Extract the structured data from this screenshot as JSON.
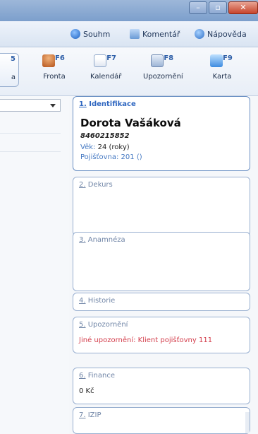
{
  "menu": {
    "souhm": "Souhm",
    "komentar": "Komentář",
    "napoveda": "Nápověda"
  },
  "toolbar": {
    "partial": {
      "key": "5",
      "label": "a"
    },
    "items": [
      {
        "key": "F6",
        "label": "Fronta"
      },
      {
        "key": "F7",
        "label": "Kalendář"
      },
      {
        "key": "F8",
        "label": "Upozornění"
      },
      {
        "key": "F9",
        "label": "Karta"
      }
    ]
  },
  "patient": {
    "section1": {
      "num": "1.",
      "label": "Identifikace"
    },
    "name": "Dorota Vašáková",
    "id": "8460215852",
    "age_label": "Věk:",
    "age_value": "24 (roky)",
    "insurance_label": "Pojišťovna:",
    "insurance_value": "201 ()"
  },
  "sections": {
    "dekurs": {
      "num": "2.",
      "label": "Dekurs"
    },
    "anamneza": {
      "num": "3.",
      "label": "Anamnéza"
    },
    "historie": {
      "num": "4.",
      "label": "Historie"
    },
    "upozorneni": {
      "num": "5.",
      "label": "Upozornění",
      "text": "Jiné upozornění: Klient pojišťovny 111"
    },
    "finance": {
      "num": "6.",
      "label": "Finance",
      "value": "0 Kč"
    },
    "izip": {
      "num": "7.",
      "label": "IZIP"
    }
  }
}
